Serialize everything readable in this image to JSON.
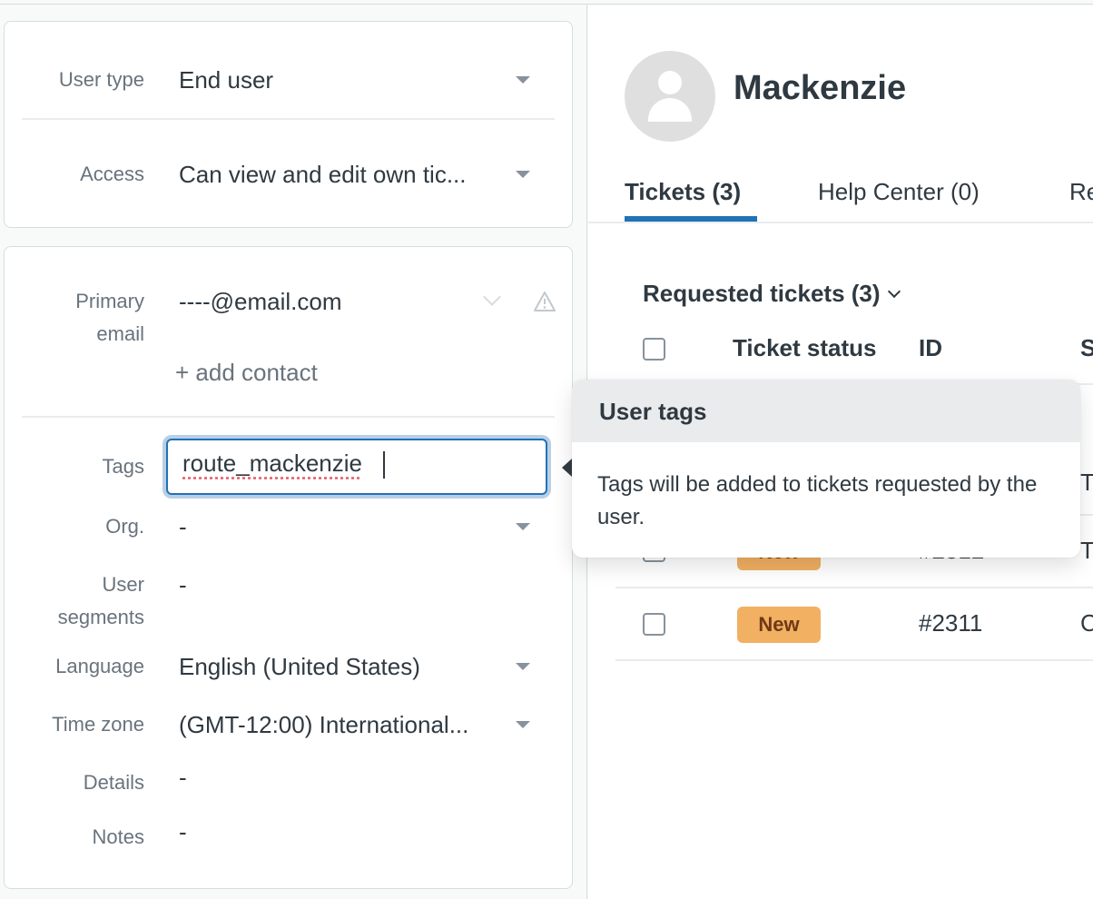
{
  "left_panel": {
    "card1": {
      "fields": [
        {
          "label": "User type",
          "value": "End user"
        },
        {
          "label": "Access",
          "value": "Can view and edit own tic..."
        }
      ]
    },
    "card2": {
      "primary_email": {
        "label_line1": "Primary",
        "label_line2": "email",
        "value": "----@email.com",
        "add_contact": "+ add contact"
      },
      "tags": {
        "label": "Tags",
        "value": "route_mackenzie"
      },
      "org": {
        "label": "Org.",
        "value": "-"
      },
      "user_segments": {
        "label_line1": "User",
        "label_line2": "segments",
        "value": "-"
      },
      "language": {
        "label": "Language",
        "value": "English (United States)"
      },
      "time_zone": {
        "label": "Time zone",
        "value": "(GMT-12:00) International..."
      },
      "details": {
        "label": "Details",
        "value": "-"
      },
      "notes": {
        "label": "Notes",
        "value": "-"
      }
    }
  },
  "profile": {
    "name": "Mackenzie",
    "tabs": [
      {
        "label": "Tickets (3)",
        "active": true
      },
      {
        "label": "Help Center (0)",
        "active": false
      },
      {
        "label": "Re",
        "active": false
      }
    ]
  },
  "tickets": {
    "section_title": "Requested tickets (3)",
    "columns": [
      "Ticket status",
      "ID",
      "S"
    ],
    "rows": [
      {
        "status": "",
        "id": "",
        "subject": "T"
      },
      {
        "status": "New",
        "id": "#2312",
        "subject": "T"
      },
      {
        "status": "New",
        "id": "#2311",
        "subject": "C"
      }
    ],
    "badge_color": "#f1b062"
  },
  "popover": {
    "title": "User tags",
    "body": "Tags will be added to tickets requested by the user."
  }
}
